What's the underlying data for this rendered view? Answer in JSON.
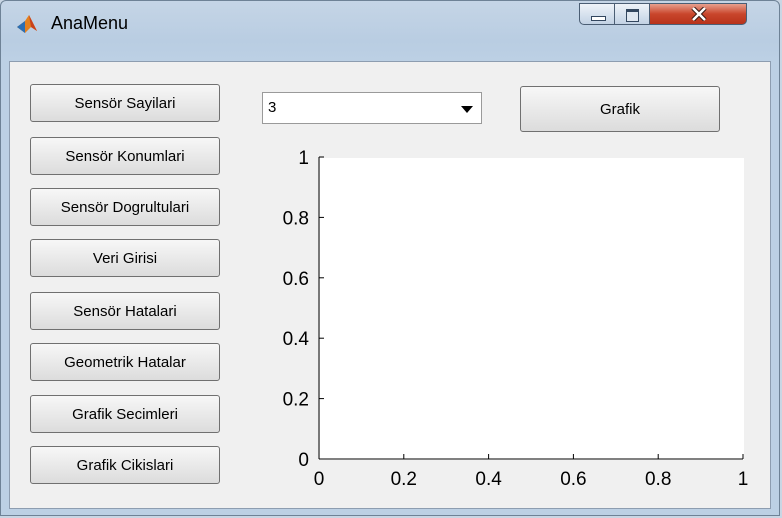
{
  "window": {
    "title": "AnaMenu",
    "title_icon": "matlab-icon",
    "controls": [
      "minimize-icon",
      "maximize-icon",
      "close-icon"
    ]
  },
  "sidebar": {
    "items": [
      {
        "label": "Sensör Sayilari"
      },
      {
        "label": "Sensör Konumlari"
      },
      {
        "label": "Sensör Dogrultulari"
      },
      {
        "label": "Veri Girisi"
      },
      {
        "label": "Sensör Hatalari"
      },
      {
        "label": "Geometrik Hatalar"
      },
      {
        "label": "Grafik Secimleri"
      },
      {
        "label": "Grafik Cikislari"
      }
    ]
  },
  "selector": {
    "value": "3"
  },
  "grafik_button": {
    "label": "Grafik"
  },
  "chart_data": {
    "type": "line",
    "title": "",
    "xlabel": "",
    "ylabel": "",
    "xlim": [
      0,
      1
    ],
    "ylim": [
      0,
      1
    ],
    "xticks": [
      "0",
      "0.2",
      "0.4",
      "0.6",
      "0.8",
      "1"
    ],
    "yticks": [
      "0",
      "0.2",
      "0.4",
      "0.6",
      "0.8",
      "1"
    ],
    "grid": false,
    "series": []
  }
}
